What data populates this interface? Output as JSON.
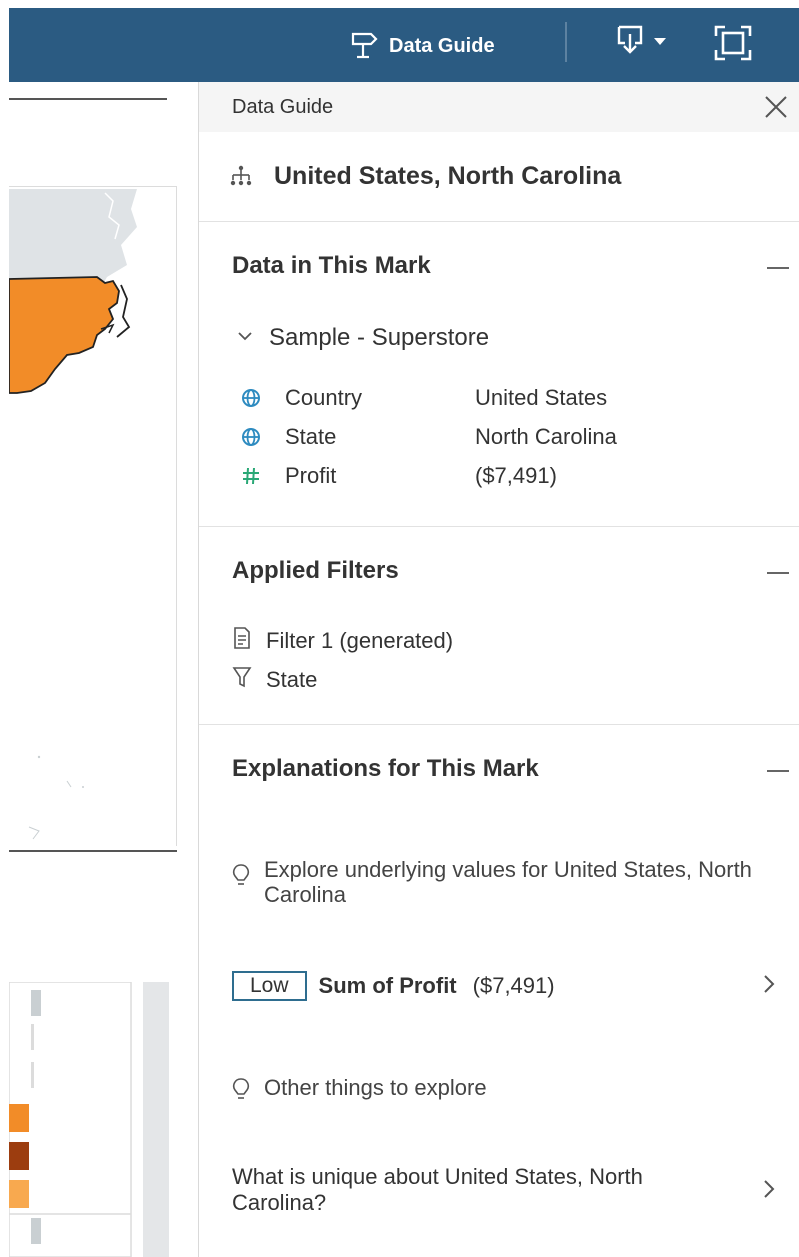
{
  "toolbar": {
    "data_guide_label": "Data Guide",
    "download_icon": "download-icon",
    "fullscreen_icon": "fullscreen-icon",
    "background_color": "#2b5b82"
  },
  "panel": {
    "header_title": "Data Guide",
    "mark_title": "United States, North Carolina",
    "data_section": {
      "title": "Data in This Mark",
      "datasource": "Sample - Superstore",
      "fields": [
        {
          "icon": "globe-icon",
          "name": "Country",
          "value": "United States"
        },
        {
          "icon": "globe-icon",
          "name": "State",
          "value": "North Carolina"
        },
        {
          "icon": "hash-icon",
          "name": "Profit",
          "value": "($7,491)"
        }
      ]
    },
    "filters_section": {
      "title": "Applied Filters",
      "filters": [
        {
          "icon": "document-icon",
          "label": "Filter 1 (generated)"
        },
        {
          "icon": "funnel-icon",
          "label": "State"
        }
      ]
    },
    "explanations_section": {
      "title": "Explanations for This Mark",
      "explore_underlying": "Explore underlying values for United States, North Carolina",
      "badge": "Low",
      "metric_label": "Sum of Profit",
      "metric_value": "($7,491)",
      "other_things": "Other things to explore",
      "unique_question": "What is unique about United States, North Carolina?"
    }
  },
  "colors": {
    "accent": "#2e6d8f",
    "map_state": "#f28c28",
    "map_land": "#dfe3e6",
    "bar_dark": "#9c3d0f",
    "bar_orange": "#f28c28",
    "bar_light_orange": "#f8a94f",
    "bar_gray": "#c9cfd2"
  }
}
